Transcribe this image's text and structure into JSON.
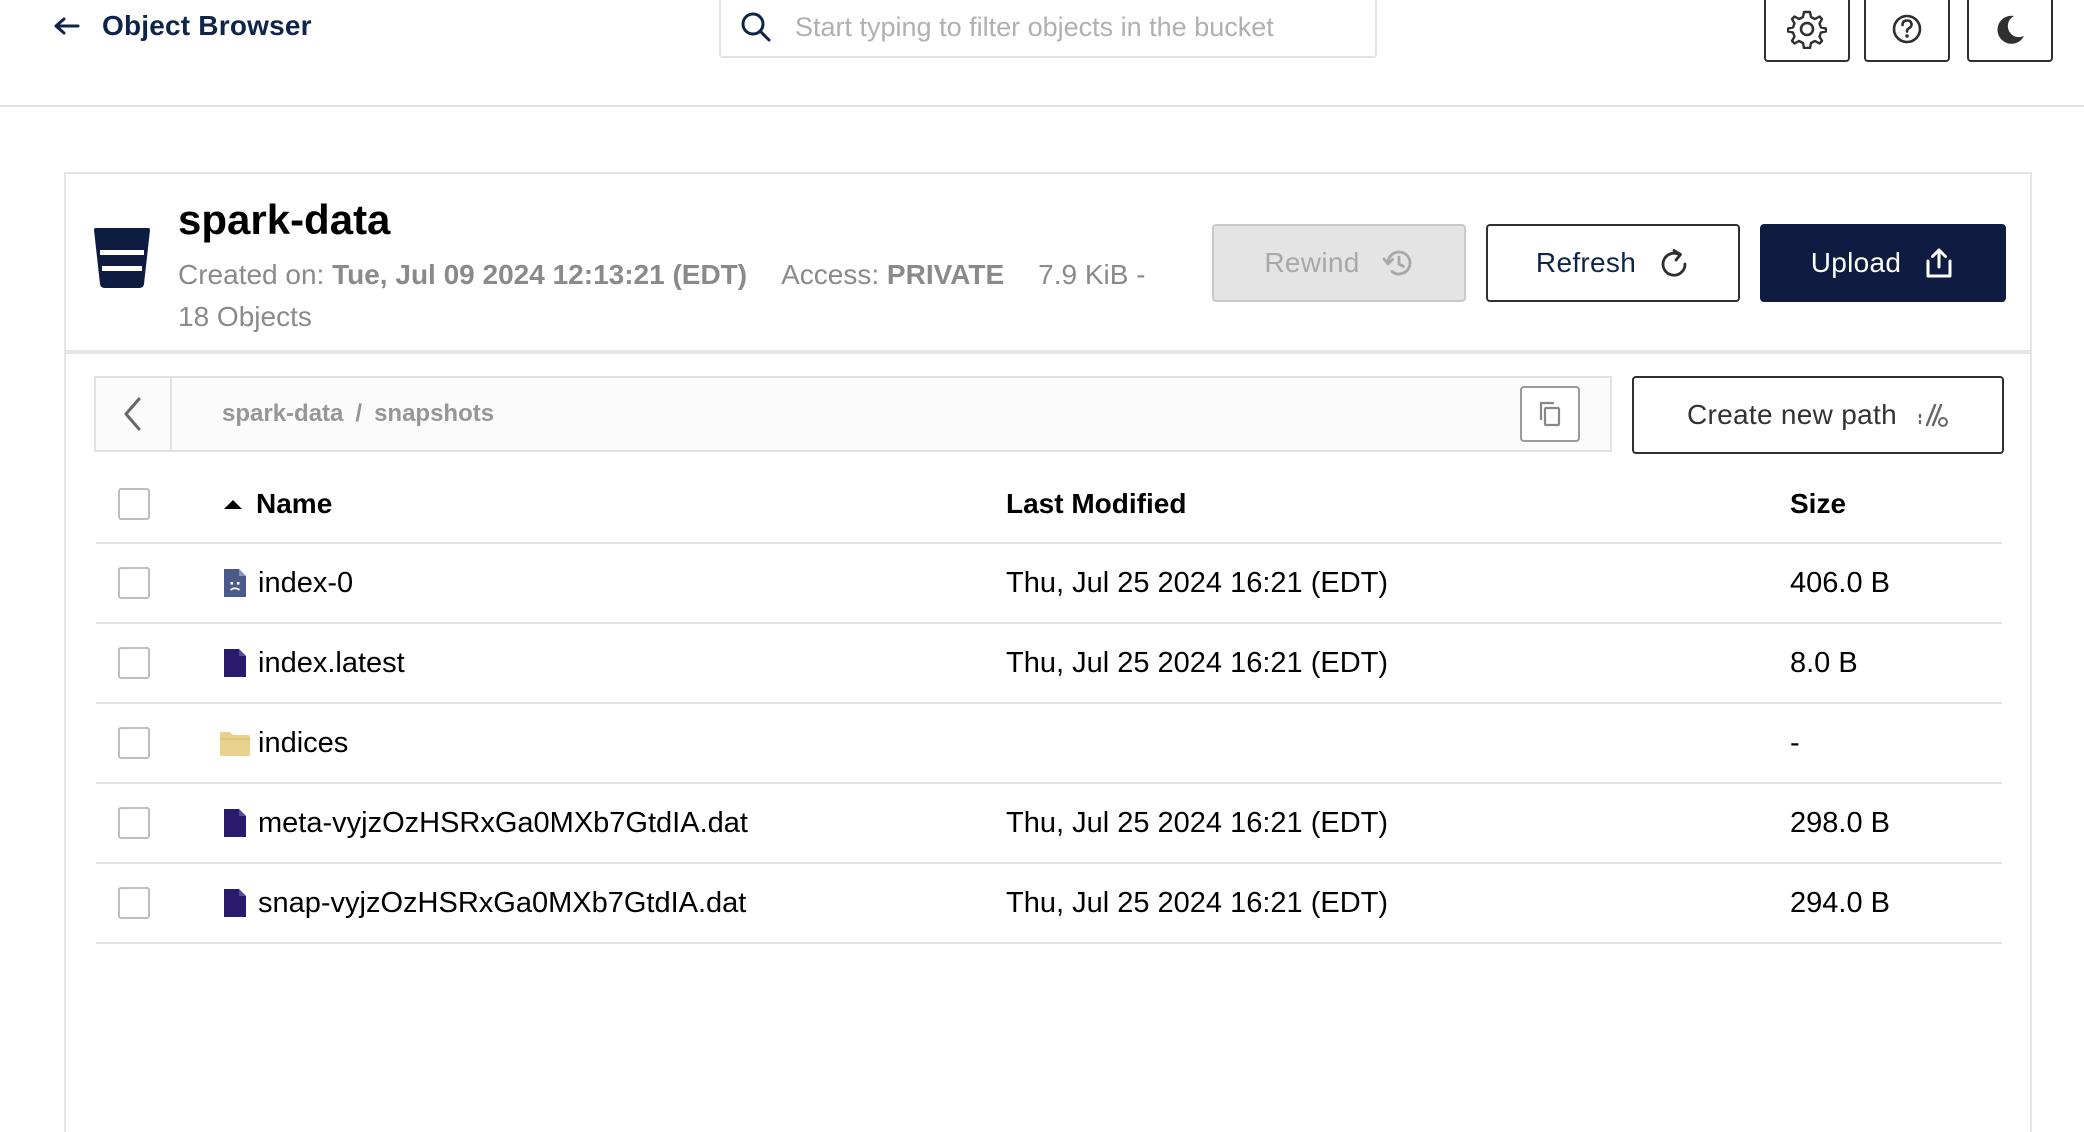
{
  "header": {
    "back_label": "Object Browser",
    "search_placeholder": "Start typing to filter objects in the bucket"
  },
  "bucket": {
    "name": "spark-data",
    "created_label": "Created on:",
    "created_value": "Tue, Jul 09 2024 12:13:21 (EDT)",
    "access_label": "Access:",
    "access_value": "PRIVATE",
    "size_summary": "7.9 KiB -",
    "object_count": "18 Objects"
  },
  "actions": {
    "rewind_label": "Rewind",
    "refresh_label": "Refresh",
    "upload_label": "Upload",
    "new_path_label": "Create new path"
  },
  "breadcrumb": {
    "segments": [
      "spark-data",
      "snapshots"
    ],
    "separator": "/"
  },
  "table": {
    "columns": {
      "name": "Name",
      "modified": "Last Modified",
      "size": "Size"
    },
    "rows": [
      {
        "name": "index-0",
        "modified": "Thu, Jul 25 2024 16:21 (EDT)",
        "size": "406.0 B",
        "icon": "unknown-file-icon"
      },
      {
        "name": "index.latest",
        "modified": "Thu, Jul 25 2024 16:21 (EDT)",
        "size": "8.0 B",
        "icon": "file-icon"
      },
      {
        "name": "indices",
        "modified": "",
        "size": "-",
        "icon": "folder-icon"
      },
      {
        "name": "meta-vyjzOzHSRxGa0MXb7GtdIA.dat",
        "modified": "Thu, Jul 25 2024 16:21 (EDT)",
        "size": "298.0 B",
        "icon": "file-icon"
      },
      {
        "name": "snap-vyjzOzHSRxGa0MXb7GtdIA.dat",
        "modified": "Thu, Jul 25 2024 16:21 (EDT)",
        "size": "294.0 B",
        "icon": "file-icon"
      }
    ]
  },
  "colors": {
    "primary_dark": "#0d1c40",
    "file_icon": "#2a1a6e",
    "folder_icon": "#e8d18c",
    "unknown_file_icon": "#4a5a8a"
  }
}
